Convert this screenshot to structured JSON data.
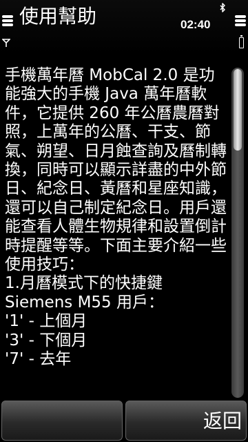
{
  "status_bar": {
    "title": "使用幫助",
    "clock": "02:40",
    "signal_icon": "signal-strength-icon",
    "battery_icon": "battery-icon",
    "bluetooth_icon": "bluetooth-icon",
    "antenna_icon": "antenna-icon"
  },
  "content": {
    "help_text": "手機萬年曆 MobCal 2.0 是功能強大的手機 Java 萬年曆軟件，它提供 260 年公曆農曆對照，上萬年的公曆、干支、節氣、朔望、日月蝕查詢及曆制轉換，同時可以顯示詳盡的中外節日、紀念日、黃曆和星座知識，還可以自己制定紀念日。用戶還能查看人體生物規律和設置倒計時提醒等等。下面主要介紹一些使用技巧：\n1.月曆模式下的快捷鍵\nSiemens M55 用戶：\n'1' - 上個月\n'3' - 下個月\n'7' - 去年"
  },
  "softkeys": {
    "left_label": "",
    "right_label": "返回"
  },
  "scroll": {
    "position_fraction": 0.0
  }
}
